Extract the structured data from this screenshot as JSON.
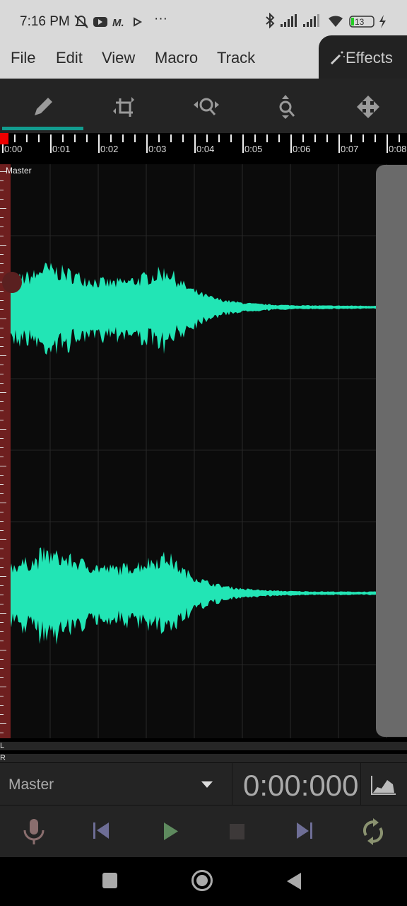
{
  "status_bar": {
    "time": "7:16 PM",
    "battery": "13",
    "icons": [
      "bell-off-icon",
      "youtube-icon",
      "app-m-icon",
      "play-store-icon",
      "more-icon",
      "bluetooth-icon",
      "signal-icon",
      "signal-icon",
      "wifi-icon",
      "battery-icon",
      "charging-icon"
    ],
    "more": "···"
  },
  "menu": {
    "items": [
      "File",
      "Edit",
      "View",
      "Macro",
      "Track"
    ],
    "effects": "Effects"
  },
  "toolbar": {
    "tools": [
      "pencil-icon",
      "crop-icon",
      "zoom-horizontal-icon",
      "zoom-vertical-icon",
      "move-icon"
    ],
    "active": 0,
    "accent": "#129c8f"
  },
  "ruler": {
    "labels": [
      "0:00",
      "0:01",
      "0:02",
      "0:03",
      "0:04",
      "0:05",
      "0:06",
      "0:07",
      "0:08"
    ]
  },
  "track": {
    "name": "Master",
    "wave_color": "#22e5b5"
  },
  "meters": {
    "left": "L",
    "right": "R"
  },
  "panel": {
    "track_select": "Master",
    "time": "0:00:000"
  },
  "transport": {
    "buttons": [
      "microphone-icon",
      "skip-back-icon",
      "play-icon",
      "stop-icon",
      "skip-forward-icon",
      "loop-icon"
    ]
  }
}
